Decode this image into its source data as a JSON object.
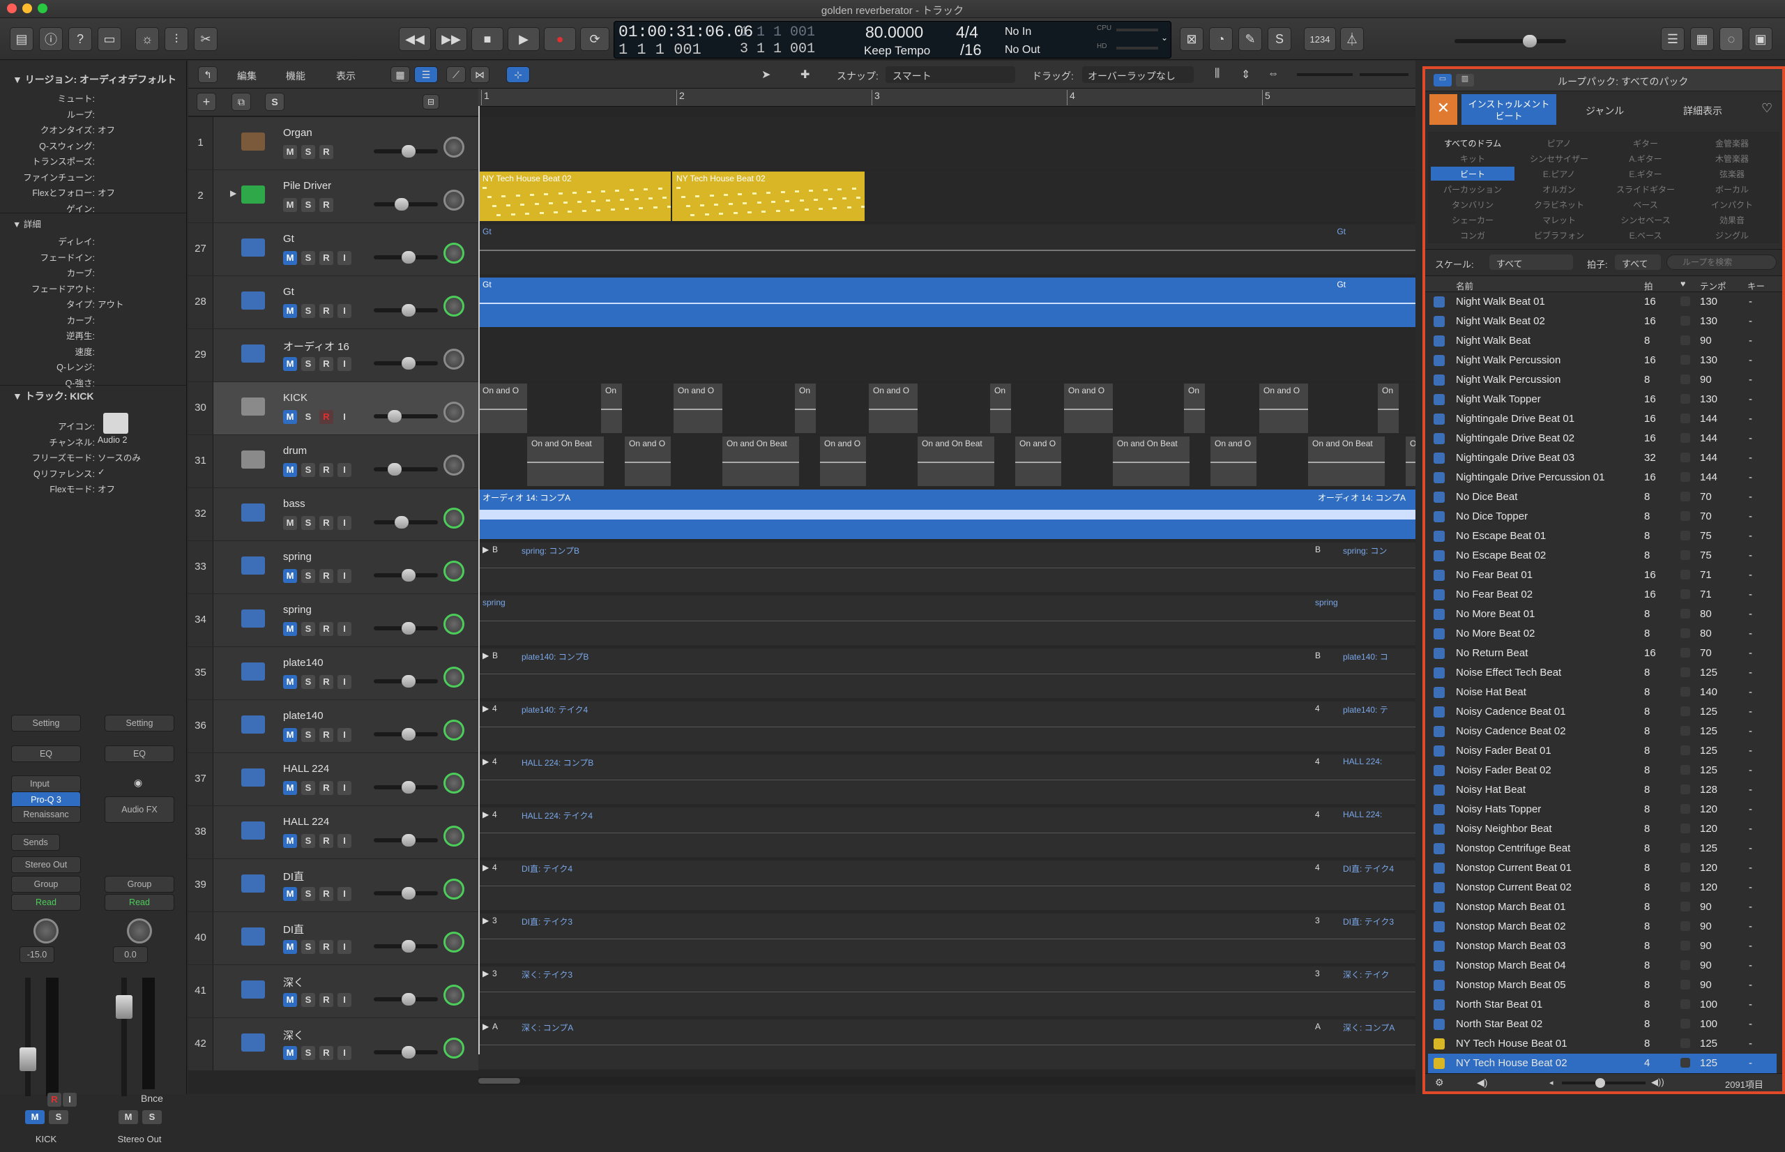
{
  "window": {
    "title": "golden reverberator - トラック"
  },
  "lcd": {
    "time": "01:00:31:06.06",
    "bars": "1   1   1   001",
    "bars2": "1   1   1   001",
    "bars3": "3   1   1   001",
    "tempo": "80.0000",
    "tempo_label": "Keep Tempo",
    "sig": "4/4",
    "div": "/16",
    "in": "No In",
    "out": "No Out",
    "cpu": "CPU",
    "hd": "HD"
  },
  "toolbar": {
    "counter": "1234"
  },
  "inspector": {
    "region_header": "リージョン: オーディオデフォルト",
    "region_rows": [
      [
        "ミュート:",
        ""
      ],
      [
        "ループ:",
        ""
      ],
      [
        "クオンタイズ:",
        "オフ"
      ],
      [
        "Q-スウィング:",
        ""
      ],
      [
        "トランスポーズ:",
        ""
      ],
      [
        "ファインチューン:",
        ""
      ],
      [
        "Flexとフォロー:",
        "オフ"
      ],
      [
        "ゲイン:",
        ""
      ]
    ],
    "detail_header": "詳細",
    "detail_rows": [
      [
        "ディレイ:",
        ""
      ],
      [
        "フェードイン:",
        ""
      ],
      [
        "カーブ:",
        ""
      ],
      [
        "フェードアウト:",
        ""
      ],
      [
        "タイプ:",
        "アウト"
      ],
      [
        "カーブ:",
        ""
      ],
      [
        "逆再生:",
        ""
      ],
      [
        "速度:",
        ""
      ],
      [
        "Q-レンジ:",
        ""
      ],
      [
        "Q-強さ:",
        ""
      ]
    ],
    "track_header": "トラック: KICK",
    "track_rows": [
      [
        "アイコン:",
        ""
      ],
      [
        "チャンネル:",
        "Audio 2"
      ],
      [
        "フリーズモード:",
        "ソースのみ"
      ],
      [
        "Qリファレンス:",
        "✓"
      ],
      [
        "Flexモード:",
        "オフ"
      ]
    ],
    "strip1": {
      "setting": "Setting",
      "eq": "EQ",
      "input": "Input",
      "plugin1": "Pro-Q 3",
      "plugin2": "Renaissanc",
      "sends": "Sends",
      "output": "Stereo Out",
      "group": "Group",
      "read": "Read",
      "value": "-15.0",
      "name": "KICK",
      "m": "M",
      "s": "S",
      "r": "R",
      "i": "I"
    },
    "strip2": {
      "setting": "Setting",
      "eq": "EQ",
      "audiofx": "Audio FX",
      "group": "Group",
      "read": "Read",
      "value": "0.0",
      "bnce": "Bnce",
      "name": "Stereo Out",
      "m": "M",
      "s": "S"
    }
  },
  "trackheader": {
    "edit": "編集",
    "func": "機能",
    "view": "表示",
    "snap_label": "スナップ:",
    "snap": "スマート",
    "drag_label": "ドラッグ:",
    "drag": "オーバーラップなし",
    "s": "S"
  },
  "ruler": [
    "1",
    "2",
    "3",
    "4",
    "5"
  ],
  "tracks": [
    {
      "num": "1",
      "name": "Organ",
      "btns": [
        "M",
        "S",
        "R"
      ],
      "icon": "organ"
    },
    {
      "num": "2",
      "name": "Pile Driver",
      "btns": [
        "M",
        "S",
        "R"
      ],
      "icon": "drummer"
    },
    {
      "num": "27",
      "name": "Gt",
      "btns": [
        "M",
        "S",
        "R",
        "I"
      ],
      "icon": "audio"
    },
    {
      "num": "28",
      "name": "Gt",
      "btns": [
        "M",
        "S",
        "R",
        "I"
      ],
      "icon": "audio"
    },
    {
      "num": "29",
      "name": "オーディオ 16",
      "btns": [
        "M",
        "S",
        "R",
        "I"
      ],
      "icon": "audio"
    },
    {
      "num": "30",
      "name": "KICK",
      "btns": [
        "M",
        "S",
        "R",
        "I"
      ],
      "icon": "drum"
    },
    {
      "num": "31",
      "name": "drum",
      "btns": [
        "M",
        "S",
        "R",
        "I"
      ],
      "icon": "drum"
    },
    {
      "num": "32",
      "name": "bass",
      "btns": [
        "M",
        "S",
        "R",
        "I"
      ],
      "icon": "audio"
    },
    {
      "num": "33",
      "name": "spring",
      "btns": [
        "M",
        "S",
        "R",
        "I"
      ],
      "icon": "audio"
    },
    {
      "num": "34",
      "name": "spring",
      "btns": [
        "M",
        "S",
        "R",
        "I"
      ],
      "icon": "audio"
    },
    {
      "num": "35",
      "name": "plate140",
      "btns": [
        "M",
        "S",
        "R",
        "I"
      ],
      "icon": "audio"
    },
    {
      "num": "36",
      "name": "plate140",
      "btns": [
        "M",
        "S",
        "R",
        "I"
      ],
      "icon": "audio"
    },
    {
      "num": "37",
      "name": "HALL 224",
      "btns": [
        "M",
        "S",
        "R",
        "I"
      ],
      "icon": "audio"
    },
    {
      "num": "38",
      "name": "HALL 224",
      "btns": [
        "M",
        "S",
        "R",
        "I"
      ],
      "icon": "audio"
    },
    {
      "num": "39",
      "name": "DI直",
      "btns": [
        "M",
        "S",
        "R",
        "I"
      ],
      "icon": "audio"
    },
    {
      "num": "40",
      "name": "DI直",
      "btns": [
        "M",
        "S",
        "R",
        "I"
      ],
      "icon": "audio"
    },
    {
      "num": "41",
      "name": "深く",
      "btns": [
        "M",
        "S",
        "R",
        "I"
      ],
      "icon": "audio"
    },
    {
      "num": "42",
      "name": "深く",
      "btns": [
        "M",
        "S",
        "R",
        "I"
      ],
      "icon": "audio"
    }
  ],
  "regions": {
    "pile": [
      "NY Tech House Beat 02",
      "NY Tech House Beat 02"
    ],
    "gt": "Gt",
    "kick": [
      "On and O",
      "On",
      "On and O",
      "On",
      "On and O",
      "On",
      "On and O",
      "On",
      "On and O",
      "On"
    ],
    "drum": [
      "On and On Beat",
      "On and O",
      "On and On Beat",
      "On and O",
      "On and On Beat",
      "On and O",
      "On and On Beat",
      "On and O",
      "On and On Beat",
      "On"
    ],
    "bass": "オーディオ 14: コンプA",
    "spring1": "spring: コンプB",
    "spring1b": "spring: コン",
    "spring2": "spring",
    "plate1": "plate140: コンプB",
    "plate1b": "plate140: コ",
    "plate2": "plate140: テイク4",
    "plate2b": "plate140: テ",
    "hall1": "HALL 224: コンプB",
    "hall1b": "HALL 224:",
    "hall2": "HALL 224: テイク4",
    "hall2b": "HALL 224:",
    "di1": "DI直: テイク4",
    "di2": "DI直: テイク3",
    "deep1": "深く: テイク3",
    "deep1b": "深く: テイク",
    "deep2": "深く: コンプA",
    "deep2b": "深く: コンプA",
    "badges": [
      "B",
      "B",
      "B",
      "4",
      "4",
      "4",
      "4",
      "3",
      "3",
      "A"
    ]
  },
  "browser": {
    "tabs_label": "ループパック: すべてのパック",
    "tab_instrument": "インストゥルメント",
    "tab_instrument_sub": "ビート",
    "tab_genre": "ジャンル",
    "tab_detail": "詳細表示",
    "categories": [
      [
        "すべてのドラム",
        "ピアノ",
        "ギター",
        "金管楽器"
      ],
      [
        "キット",
        "シンセサイザー",
        "A.ギター",
        "木管楽器"
      ],
      [
        "ビート",
        "E.ピアノ",
        "E.ギター",
        "弦楽器"
      ],
      [
        "パーカッション",
        "オルガン",
        "スライドギター",
        "ボーカル"
      ],
      [
        "タンバリン",
        "クラビネット",
        "ベース",
        "インパクト"
      ],
      [
        "シェーカー",
        "マレット",
        "シンセベース",
        "効果音"
      ],
      [
        "コンガ",
        "ビブラフォン",
        "E.ベース",
        "ジングル"
      ]
    ],
    "scale_label": "スケール:",
    "scale": "すべて",
    "beat_label": "拍子:",
    "beat": "すべて",
    "search_placeholder": "ループを検索",
    "columns": {
      "name": "名前",
      "beats": "拍",
      "tempo": "テンポ",
      "key": "キー"
    },
    "rows": [
      [
        "Night Walk Beat 01",
        "16",
        "130",
        "-"
      ],
      [
        "Night Walk Beat 02",
        "16",
        "130",
        "-"
      ],
      [
        "Night Walk Beat",
        "8",
        "90",
        "-"
      ],
      [
        "Night Walk Percussion",
        "16",
        "130",
        "-"
      ],
      [
        "Night Walk Percussion",
        "8",
        "90",
        "-"
      ],
      [
        "Night Walk Topper",
        "16",
        "130",
        "-"
      ],
      [
        "Nightingale Drive Beat 01",
        "16",
        "144",
        "-"
      ],
      [
        "Nightingale Drive Beat 02",
        "16",
        "144",
        "-"
      ],
      [
        "Nightingale Drive Beat 03",
        "32",
        "144",
        "-"
      ],
      [
        "Nightingale Drive Percussion 01",
        "16",
        "144",
        "-"
      ],
      [
        "No Dice Beat",
        "8",
        "70",
        "-"
      ],
      [
        "No Dice Topper",
        "8",
        "70",
        "-"
      ],
      [
        "No Escape Beat 01",
        "8",
        "75",
        "-"
      ],
      [
        "No Escape Beat 02",
        "8",
        "75",
        "-"
      ],
      [
        "No Fear Beat 01",
        "16",
        "71",
        "-"
      ],
      [
        "No Fear Beat 02",
        "16",
        "71",
        "-"
      ],
      [
        "No More Beat 01",
        "8",
        "80",
        "-"
      ],
      [
        "No More Beat 02",
        "8",
        "80",
        "-"
      ],
      [
        "No Return Beat",
        "16",
        "70",
        "-"
      ],
      [
        "Noise Effect Tech Beat",
        "8",
        "125",
        "-"
      ],
      [
        "Noise Hat Beat",
        "8",
        "140",
        "-"
      ],
      [
        "Noisy Cadence Beat 01",
        "8",
        "125",
        "-"
      ],
      [
        "Noisy Cadence Beat 02",
        "8",
        "125",
        "-"
      ],
      [
        "Noisy Fader Beat 01",
        "8",
        "125",
        "-"
      ],
      [
        "Noisy Fader Beat 02",
        "8",
        "125",
        "-"
      ],
      [
        "Noisy Hat Beat",
        "8",
        "128",
        "-"
      ],
      [
        "Noisy Hats Topper",
        "8",
        "120",
        "-"
      ],
      [
        "Noisy Neighbor Beat",
        "8",
        "120",
        "-"
      ],
      [
        "Nonstop Centrifuge Beat",
        "8",
        "125",
        "-"
      ],
      [
        "Nonstop Current Beat 01",
        "8",
        "120",
        "-"
      ],
      [
        "Nonstop Current Beat 02",
        "8",
        "120",
        "-"
      ],
      [
        "Nonstop March Beat 01",
        "8",
        "90",
        "-"
      ],
      [
        "Nonstop March Beat 02",
        "8",
        "90",
        "-"
      ],
      [
        "Nonstop March Beat 03",
        "8",
        "90",
        "-"
      ],
      [
        "Nonstop March Beat 04",
        "8",
        "90",
        "-"
      ],
      [
        "Nonstop March Beat 05",
        "8",
        "90",
        "-"
      ],
      [
        "North Star Beat 01",
        "8",
        "100",
        "-"
      ],
      [
        "North Star Beat 02",
        "8",
        "100",
        "-"
      ],
      [
        "NY Tech House Beat 01",
        "8",
        "125",
        "-"
      ],
      [
        "NY Tech House Beat 02",
        "4",
        "125",
        "-"
      ]
    ],
    "count": "2091項目"
  },
  "colors": {
    "accent": "#e04a28",
    "yellow": "#d9b626",
    "blue": "#2e6fc7",
    "selected": "#2e6fc7"
  }
}
